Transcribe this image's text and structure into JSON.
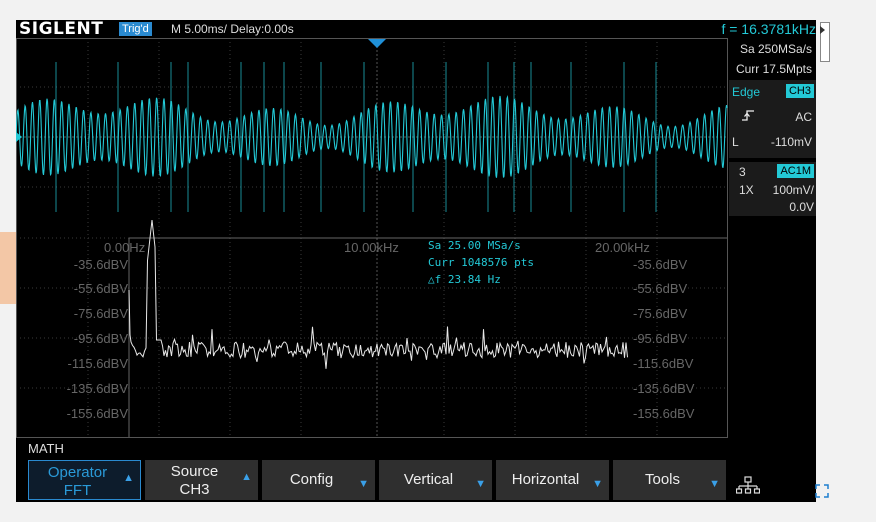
{
  "header": {
    "brand": "SIGLENT",
    "trigger_status": "Trig'd",
    "timebase": "M 5.00ms/ Delay:0.00s",
    "frequency": "f = 16.3781kHz"
  },
  "acquisition": {
    "sample_rate": "Sa 250MSa/s",
    "memory_depth": "Curr 17.5Mpts"
  },
  "trigger_panel": {
    "type_label": "Edge",
    "source": "CH3",
    "slope_icon": "rising-edge-icon",
    "coupling": "AC",
    "level_label": "L",
    "level_value": "-110mV"
  },
  "channel_panel": {
    "number": "3",
    "coupling": "AC1M",
    "probe": "1X",
    "scale": "100mV/",
    "offset": "0.0V"
  },
  "fft": {
    "freq_labels": [
      "0.00Hz",
      "10.00kHz",
      "20.00kHz"
    ],
    "left_db_labels": [
      "-35.6dBV",
      "-55.6dBV",
      "-75.6dBV",
      "-95.6dBV",
      "-115.6dBV",
      "-135.6dBV",
      "-155.6dBV"
    ],
    "right_db_labels": [
      "-35.6dBV",
      "-55.6dBV",
      "-75.6dBV",
      "-95.6dBV",
      "-115.6dBV",
      "-135.6dBV",
      "-155.6dBV"
    ],
    "info_sample_rate": "Sa 25.00 MSa/s",
    "info_points": "Curr 1048576 pts",
    "info_resolution": "△f 23.84 Hz"
  },
  "menu": {
    "title": "MATH",
    "operator_label": "Operator",
    "operator_value": "FFT",
    "source_label": "Source",
    "source_value": "CH3",
    "config_label": "Config",
    "vertical_label": "Vertical",
    "horizontal_label": "Horizontal",
    "tools_label": "Tools"
  },
  "colors": {
    "channel3": "#23c9d6",
    "math": "#e8e8e8",
    "accent_blue": "#2a8ad0"
  }
}
